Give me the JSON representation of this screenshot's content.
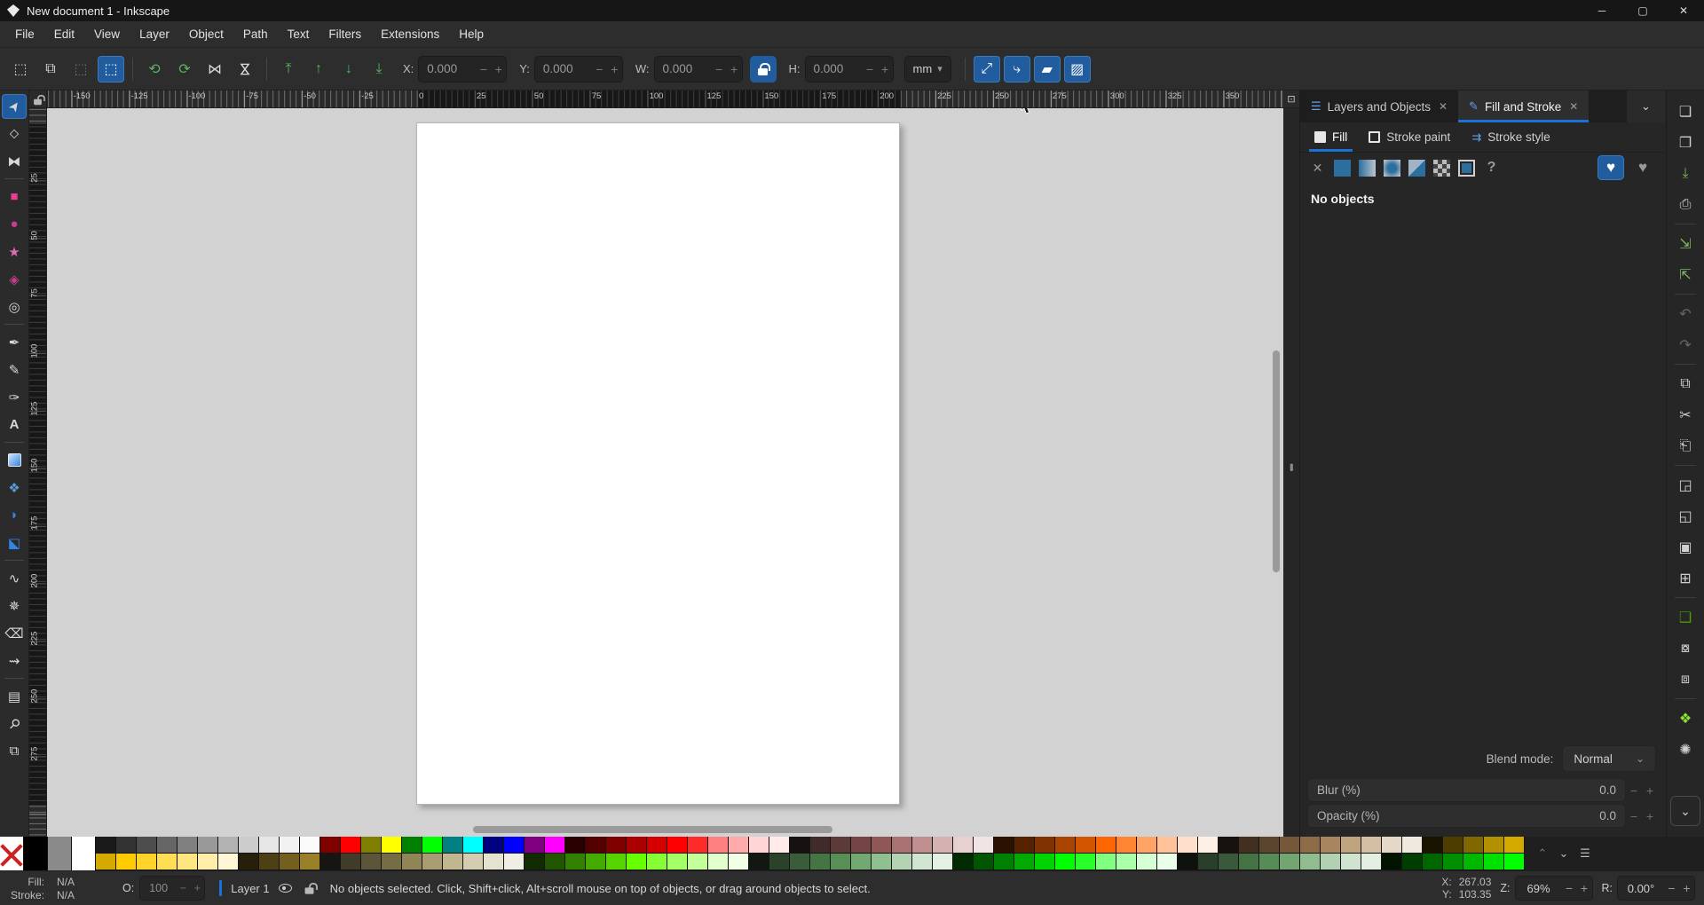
{
  "window": {
    "title": "New document 1 - Inkscape",
    "buttons": {
      "minimize": "─",
      "maximize": "▢",
      "close": "✕"
    }
  },
  "menu": {
    "items": [
      "File",
      "Edit",
      "View",
      "Layer",
      "Object",
      "Path",
      "Text",
      "Filters",
      "Extensions",
      "Help"
    ]
  },
  "tool_controls": {
    "left_buttons": [
      {
        "name": "select-all-button",
        "glyph": "⬚"
      },
      {
        "name": "select-all-layers-button",
        "glyph": "⧉"
      },
      {
        "name": "deselect-button",
        "glyph": "⬚",
        "dim": true
      },
      {
        "name": "selection-box-toggle",
        "glyph": "⬚",
        "active": true
      },
      {
        "sep": true
      },
      {
        "name": "rotate-ccw-button",
        "glyph": "⟲",
        "color": "#56b45d"
      },
      {
        "name": "rotate-cw-button",
        "glyph": "⟳",
        "color": "#56b45d"
      },
      {
        "name": "flip-horizontal-button",
        "glyph": "⋈"
      },
      {
        "name": "flip-vertical-button",
        "glyph": "⋈",
        "rot": 90
      },
      {
        "sep": true
      },
      {
        "name": "raise-to-top-button",
        "glyph": "⤒",
        "color": "#56b45d"
      },
      {
        "name": "raise-button",
        "glyph": "↑",
        "color": "#56b45d"
      },
      {
        "name": "lower-button",
        "glyph": "↓",
        "color": "#56b45d"
      },
      {
        "name": "lower-to-bottom-button",
        "glyph": "⤓",
        "color": "#56b45d"
      }
    ],
    "x_label": "X:",
    "x_value": "0.000",
    "y_label": "Y:",
    "y_value": "0.000",
    "w_label": "W:",
    "w_value": "0.000",
    "h_label": "H:",
    "h_value": "0.000",
    "minus": "−",
    "plus": "+",
    "unit": "mm",
    "unit_chevron": "▾",
    "right_toggles": [
      {
        "name": "scale-stroke-toggle",
        "glyph": "⤢",
        "active": true
      },
      {
        "name": "scale-corners-toggle",
        "glyph": "⤷",
        "active": true
      },
      {
        "name": "move-gradients-toggle",
        "glyph": "▰",
        "active": true
      },
      {
        "name": "move-patterns-toggle",
        "glyph": "▨",
        "active": true
      }
    ]
  },
  "toolbox": [
    {
      "name": "selector-tool",
      "glyph": "➤",
      "active": true,
      "rot": -55
    },
    {
      "name": "node-tool",
      "glyph": "⬦"
    },
    {
      "name": "shape-builder-tool",
      "glyph": "⧓"
    },
    {
      "sep": true
    },
    {
      "name": "rectangle-tool",
      "glyph": "■",
      "color": "#e83b9a"
    },
    {
      "name": "ellipse-tool",
      "glyph": "●",
      "color": "#c73e8e"
    },
    {
      "name": "star-tool",
      "glyph": "★",
      "color": "#db6fb0"
    },
    {
      "name": "box3d-tool",
      "glyph": "◈",
      "color": "#c73e8e"
    },
    {
      "name": "spiral-tool",
      "glyph": "◎"
    },
    {
      "sep": true
    },
    {
      "name": "pen-tool",
      "glyph": "✒"
    },
    {
      "name": "pencil-tool",
      "glyph": "✎"
    },
    {
      "name": "calligraphy-tool",
      "glyph": "✑"
    },
    {
      "name": "text-tool",
      "glyph": "A",
      "bold": true
    },
    {
      "sep": true
    },
    {
      "name": "gradient-tool",
      "kind": "gradient"
    },
    {
      "name": "mesh-gradient-tool",
      "glyph": "❖",
      "color": "#5b9bd5"
    },
    {
      "name": "dropper-tool",
      "glyph": "◗",
      "color": "#3584e4"
    },
    {
      "name": "paint-bucket-tool",
      "glyph": "⬕",
      "color": "#3584e4"
    },
    {
      "sep": true
    },
    {
      "name": "tweak-tool",
      "glyph": "∿"
    },
    {
      "name": "spray-tool",
      "glyph": "✵"
    },
    {
      "name": "eraser-tool",
      "glyph": "⌫"
    },
    {
      "name": "connector-tool",
      "glyph": "⇝"
    },
    {
      "sep": true
    },
    {
      "name": "measure-tool",
      "glyph": "▤"
    },
    {
      "name": "zoom-tool",
      "glyph": "⚲",
      "rot": 45
    },
    {
      "name": "pages-tool",
      "glyph": "⧉"
    }
  ],
  "rulers": {
    "h_labels": [
      "-150",
      "-125",
      "-100",
      "-75",
      "-50",
      "-25",
      "0",
      "25",
      "50",
      "75",
      "100",
      "125",
      "150",
      "175",
      "200",
      "225",
      "250",
      "275",
      "300",
      "325",
      "350"
    ],
    "v_labels": [
      "25",
      "50",
      "75",
      "100",
      "125",
      "150",
      "175",
      "200",
      "225",
      "250",
      "275"
    ]
  },
  "right_panel": {
    "tabs": [
      {
        "label": "Layers and Objects",
        "close": "✕",
        "icon": "☰"
      },
      {
        "label": "Fill and Stroke",
        "close": "✕",
        "icon": "✎",
        "active": true
      }
    ],
    "panel_menu_chevron": "⌄",
    "subtabs": [
      {
        "label": "Fill",
        "kind": "fill",
        "active": true
      },
      {
        "label": "Stroke paint",
        "kind": "stroke"
      },
      {
        "label": "Stroke style",
        "kind": "style",
        "icon": "⇉"
      }
    ],
    "paint_types": [
      {
        "name": "paint-none-button",
        "kind": "none",
        "glyph": "✕"
      },
      {
        "name": "paint-flat-button",
        "kind": "flat"
      },
      {
        "name": "paint-linear-gradient-button",
        "kind": "linear"
      },
      {
        "name": "paint-radial-gradient-button",
        "kind": "radial"
      },
      {
        "name": "paint-pattern-button",
        "kind": "pattern"
      },
      {
        "name": "paint-swatch-button",
        "kind": "checker"
      },
      {
        "name": "paint-mesh-button",
        "kind": "bordered"
      },
      {
        "name": "paint-unknown-button",
        "kind": "unknown",
        "glyph": "?"
      }
    ],
    "fill_rules": [
      {
        "name": "fill-rule-even-odd-button",
        "glyph": "♥",
        "active": true
      },
      {
        "name": "fill-rule-nonzero-button",
        "glyph": "♥"
      }
    ],
    "message": "No objects",
    "blend_label": "Blend mode:",
    "blend_value": "Normal",
    "blend_chevron": "⌄",
    "blur_label": "Blur (%)",
    "blur_value": "0.0",
    "opacity_label": "Opacity (%)",
    "opacity_value": "0.0",
    "minus": "−",
    "plus": "+"
  },
  "command_bar": [
    {
      "name": "new-document-button",
      "glyph": "❏"
    },
    {
      "name": "open-document-button",
      "glyph": "❐"
    },
    {
      "name": "save-document-button",
      "glyph": "⤓",
      "color": "#7bb661"
    },
    {
      "name": "print-button",
      "glyph": "⎙"
    },
    {
      "sep": true
    },
    {
      "name": "import-button",
      "glyph": "⇲",
      "color": "#7bb661"
    },
    {
      "name": "export-button",
      "glyph": "⇱",
      "color": "#7bb661"
    },
    {
      "sep": true
    },
    {
      "name": "undo-button",
      "glyph": "↶",
      "dim": true
    },
    {
      "name": "redo-button",
      "glyph": "↷",
      "dim": true
    },
    {
      "sep": true
    },
    {
      "name": "copy-button",
      "glyph": "⧉"
    },
    {
      "name": "cut-button",
      "glyph": "✂"
    },
    {
      "name": "paste-button",
      "glyph": "⎗"
    },
    {
      "sep": true
    },
    {
      "name": "zoom-selection-button",
      "glyph": "◲"
    },
    {
      "name": "zoom-drawing-button",
      "glyph": "◱"
    },
    {
      "name": "zoom-page-button",
      "glyph": "▣"
    },
    {
      "name": "zoom-center-page-button",
      "glyph": "⊞"
    },
    {
      "sep": true
    },
    {
      "name": "duplicate-button",
      "glyph": "❑",
      "color": "#4e9a06"
    },
    {
      "name": "create-clone-button",
      "glyph": "⧇"
    },
    {
      "name": "unlink-clone-button",
      "glyph": "⧈"
    },
    {
      "sep": true
    },
    {
      "name": "group-button",
      "glyph": "❖",
      "color": "#8ae234"
    },
    {
      "name": "open-fill-stroke-button",
      "glyph": "✺"
    }
  ],
  "command_bar_expander": "⌄",
  "palette": {
    "big": [
      {
        "name": "swatch-none",
        "kind": "none"
      },
      {
        "name": "swatch-black",
        "color": "#000000"
      },
      {
        "name": "swatch-gray",
        "color": "#8a8a8a"
      },
      {
        "name": "swatch-white",
        "color": "#ffffff"
      }
    ],
    "row1": [
      "#1a1a1a",
      "#333333",
      "#4d4d4d",
      "#666666",
      "#808080",
      "#999999",
      "#b3b3b3",
      "#cccccc",
      "#e6e6e6",
      "#f2f2f2",
      "#fbfbfb",
      "#800000",
      "#ff0000",
      "#808000",
      "#ffff00",
      "#008000",
      "#00ff00",
      "#008080",
      "#00ffff",
      "#000080",
      "#0000ff",
      "#800080",
      "#ff00ff",
      "#2b0000",
      "#550000",
      "#800000",
      "#aa0000",
      "#d40000",
      "#ff0000",
      "#ff2a2a",
      "#ff8080",
      "#ffaaaa",
      "#ffd5d5",
      "#ffeaea",
      "#171212",
      "#412a2a",
      "#5c3a3a",
      "#754545",
      "#8f5757",
      "#a87272",
      "#c09090",
      "#d4b2b2",
      "#e6d0d0",
      "#f0e4e4",
      "#2b1100",
      "#552200",
      "#803300",
      "#aa4400",
      "#d45500",
      "#ff6600",
      "#ff8533",
      "#ffa366",
      "#ffc299",
      "#ffe0cc",
      "#fff0e5",
      "#17120e",
      "#41301f",
      "#5c452e",
      "#75583a",
      "#8f6c48",
      "#a8855f",
      "#c0a37f",
      "#d4bfa4",
      "#e6d8c8",
      "#f0e9df",
      "#191400",
      "#4d3e00",
      "#806700",
      "#b39000",
      "#d4aa00"
    ],
    "row2": [
      "#d4aa00",
      "#ffcc00",
      "#ffd42a",
      "#ffdd55",
      "#ffe680",
      "#ffeeaa",
      "#fff6d5",
      "#26200a",
      "#4d4014",
      "#73601e",
      "#998028",
      "#171512",
      "#413c2a",
      "#5c553a",
      "#756d45",
      "#8f8557",
      "#a89d72",
      "#c0b790",
      "#d4cdb2",
      "#e6e2d0",
      "#f0eee4",
      "#112b00",
      "#225500",
      "#338000",
      "#44aa00",
      "#55d400",
      "#66ff00",
      "#85ff33",
      "#a3ff66",
      "#c2ff99",
      "#e0ffcc",
      "#f0ffe5",
      "#121712",
      "#2a412a",
      "#3a5c3a",
      "#457545",
      "#578f57",
      "#72a872",
      "#90c090",
      "#b2d4b2",
      "#d0e6d0",
      "#e4f0e4",
      "#002b00",
      "#005500",
      "#008000",
      "#00aa00",
      "#00d400",
      "#00ff00",
      "#2aff2a",
      "#80ff80",
      "#aaffaa",
      "#d5ffd5",
      "#eaffea",
      "#0d120d",
      "#2a3f2a",
      "#3a593a",
      "#457245",
      "#578c57",
      "#72a572",
      "#90bd90",
      "#b2d1b2",
      "#d0e3d0",
      "#e4efe4",
      "#001400",
      "#003d00",
      "#006600",
      "#008f00",
      "#00b800",
      "#00e100",
      "#00ff00"
    ],
    "scroll_up": "⌃",
    "scroll_down": "⌄",
    "config_menu": "☰"
  },
  "status_bar": {
    "fill_label": "Fill:",
    "fill_value": "N/A",
    "stroke_label": "Stroke:",
    "stroke_value": "N/A",
    "opacity_label": "O:",
    "opacity_value": "100",
    "minus": "−",
    "plus": "+",
    "layer_label": "Layer 1",
    "message": "No objects selected. Click, Shift+click, Alt+scroll mouse on top of objects, or drag around objects to select.",
    "x_label": "X:",
    "x_value": "267.03",
    "y_label": "Y:",
    "y_value": "103.35",
    "zoom_label": "Z:",
    "zoom_value": "69%",
    "rotation_label": "R:",
    "rotation_value": "0.00°"
  }
}
